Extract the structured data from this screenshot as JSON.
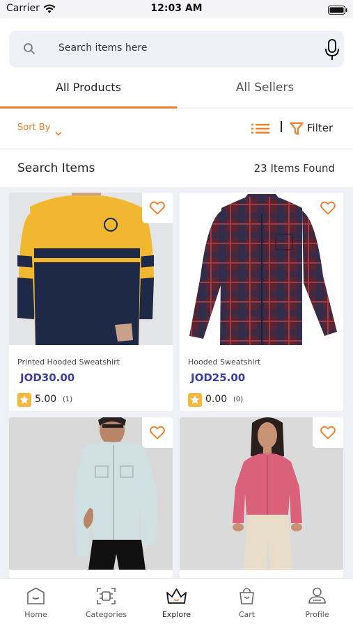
{
  "status_bar": {
    "carrier": "Carrier",
    "time": "12:03 AM"
  },
  "search": {
    "placeholder": "Search items here"
  },
  "tabs": [
    {
      "label": "All Products",
      "active": true
    },
    {
      "label": "All Sellers",
      "active": false
    }
  ],
  "toolbar": {
    "sort_label": "Sort By",
    "filter_label": "Filter"
  },
  "results": {
    "title": "Search Items",
    "count": "23 Items Found"
  },
  "products": [
    {
      "name": "Printed Hooded Sweatshirt",
      "price": "JOD30.00",
      "rating": "5.00",
      "rating_count": "(1)"
    },
    {
      "name": "Hooded Sweatshirt",
      "price": "JOD25.00",
      "rating": "0.00",
      "rating_count": "(0)"
    },
    {
      "name": "",
      "price": "",
      "rating": "",
      "rating_count": ""
    },
    {
      "name": "",
      "price": "",
      "rating": "",
      "rating_count": ""
    }
  ],
  "bottom_nav": [
    {
      "label": "Home",
      "icon": "home-icon"
    },
    {
      "label": "Categories",
      "icon": "categories-icon"
    },
    {
      "label": "Explore",
      "icon": "crown-icon",
      "active": true
    },
    {
      "label": "Cart",
      "icon": "cart-icon"
    },
    {
      "label": "Profile",
      "icon": "profile-icon"
    }
  ],
  "colors": {
    "accent": "#ef7f2b",
    "price": "#3d3fa8",
    "grid_bg": "#eef0f6"
  }
}
